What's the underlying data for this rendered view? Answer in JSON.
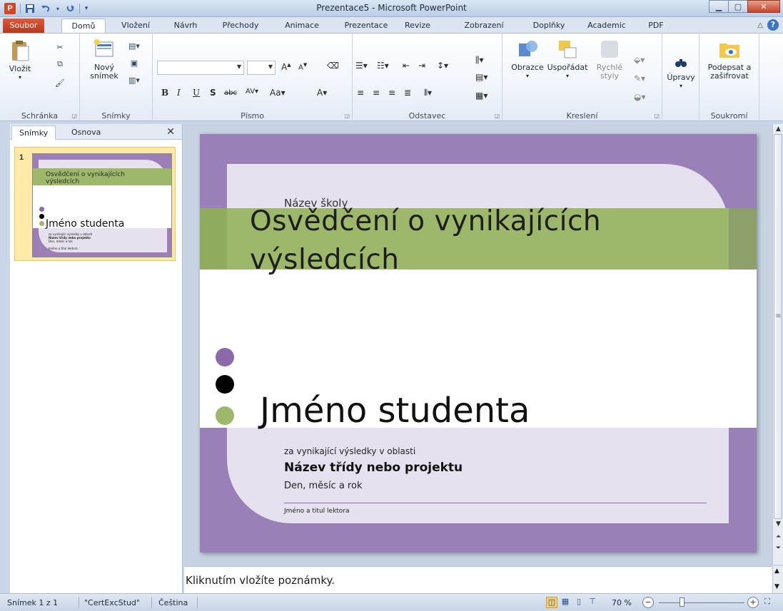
{
  "window": {
    "title": "Prezentace5 - Microsoft PowerPoint",
    "app_icon_letter": "P"
  },
  "tabs": [
    "Soubor",
    "Domů",
    "Vložení",
    "Návrh",
    "Přechody",
    "Animace",
    "Prezentace",
    "Revize",
    "Zobrazení",
    "Doplňky",
    "Academic",
    "PDF"
  ],
  "ribbon": {
    "clipboard": {
      "paste_label": "Vložit",
      "group_label": "Schránka"
    },
    "slides": {
      "new_slide_label_1": "Nový",
      "new_slide_label_2": "snímek",
      "group_label": "Snímky"
    },
    "font": {
      "group_label": "Písmo",
      "font_name": "",
      "font_size": ""
    },
    "paragraph": {
      "group_label": "Odstavec"
    },
    "drawing": {
      "shapes_label": "Obrazce",
      "arrange_label": "Uspořádat",
      "styles_label_1": "Rychlé",
      "styles_label_2": "styly",
      "group_label": "Kreslení"
    },
    "editing": {
      "label": "Úpravy"
    },
    "privacy": {
      "sign_label_1": "Podepsat a",
      "sign_label_2": "zašifrovat",
      "group_label": "Soukromí"
    }
  },
  "left_pane": {
    "tab_slides": "Snímky",
    "tab_outline": "Osnova",
    "thumbnail": {
      "number": "1",
      "title": "Osvědčení o vynikajících výsledcích",
      "student": "Jméno studenta",
      "for_text": "za vynikající výsledky v oblasti",
      "class_name": "Název třídy nebo projektu",
      "date": "Den, měsíc a rok",
      "lector": "Jméno a titul lektora"
    }
  },
  "slide": {
    "school": "Název školy",
    "title": "Osvědčení o vynikajících výsledcích",
    "student": "Jméno studenta",
    "for_text": "za vynikající výsledky v oblasti",
    "class_name": "Název třídy nebo projektu",
    "date": "Den, měsíc a rok",
    "lector": "Jméno a titul lektora",
    "colors": {
      "frame": "#9a80b8",
      "card": "#e6e1ee",
      "band": "#9db86a",
      "dot_purple": "#8a6aa8",
      "dot_black": "#000000",
      "dot_green": "#9db86a"
    }
  },
  "notes": {
    "placeholder": "Kliknutím vložíte poznámky."
  },
  "status": {
    "slide_counter": "Snímek 1 z 1",
    "theme": "\"CertExcStud\"",
    "language": "Čeština",
    "zoom": "70 %"
  },
  "icons": {
    "save": "save-icon",
    "undo": "undo-icon",
    "redo": "redo-icon",
    "cut": "scissors-icon",
    "copy": "copy-icon",
    "format_painter": "format-painter-icon",
    "find": "binoculars-icon",
    "help": "help-icon"
  }
}
